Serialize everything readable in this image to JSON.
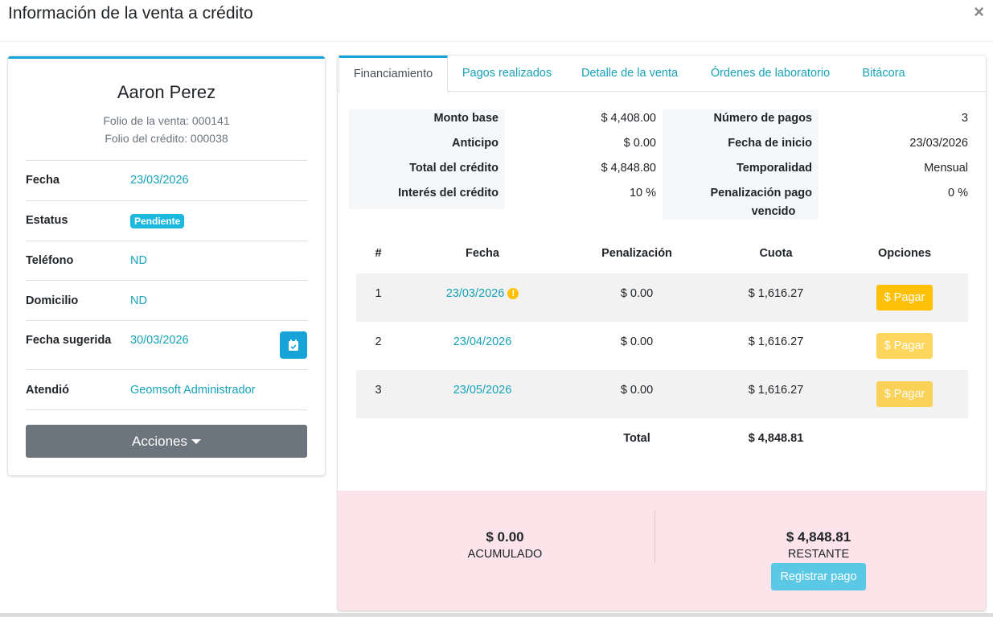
{
  "modal": {
    "title": "Información de la venta a crédito",
    "close_label": "×"
  },
  "client": {
    "name": "Aaron Perez",
    "folio_venta": "Folio de la venta: 000141",
    "folio_credito": "Folio del crédito: 000038",
    "rows": {
      "fecha": {
        "label": "Fecha",
        "value": "23/03/2026"
      },
      "estatus": {
        "label": "Estatus",
        "value": "Pendiente"
      },
      "telefono": {
        "label": "Teléfono",
        "value": "ND"
      },
      "domicilio": {
        "label": "Domicilio",
        "value": "ND"
      },
      "fecha_sugerida": {
        "label": "Fecha sugerida",
        "value": "30/03/2026"
      },
      "atendio": {
        "label": "Atendió",
        "value": "Geomsoft Administrador"
      }
    },
    "acciones_label": "Acciones"
  },
  "tabs": [
    "Financiamiento",
    "Pagos realizados",
    "Detalle de la venta",
    "Órdenes de laboratorio",
    "Bitácora"
  ],
  "financing": {
    "monto_base": {
      "label": "Monto base",
      "value": "$ 4,408.00"
    },
    "anticipo": {
      "label": "Anticipo",
      "value": "$ 0.00"
    },
    "total_credito": {
      "label": "Total del crédito",
      "value": "$ 4,848.80"
    },
    "interes": {
      "label": "Interés del crédito",
      "value": "10 %"
    },
    "numero_pagos": {
      "label": "Número de pagos",
      "value": "3"
    },
    "fecha_inicio": {
      "label": "Fecha de inicio",
      "value": "23/03/2026"
    },
    "temporalidad": {
      "label": "Temporalidad",
      "value": "Mensual"
    },
    "penalizacion": {
      "label_1": "Penalización pago",
      "label_2": "vencido",
      "value": "0 %"
    }
  },
  "table": {
    "headers": [
      "#",
      "Fecha",
      "Penalización",
      "Cuota",
      "Opciones"
    ],
    "rows": [
      {
        "num": "1",
        "fecha": "23/03/2026",
        "penalizacion": "$ 0.00",
        "cuota": "$ 1,616.27",
        "button": "Pagar"
      },
      {
        "num": "2",
        "fecha": "23/04/2026",
        "penalizacion": "$ 0.00",
        "cuota": "$ 1,616.27",
        "button": "Pagar"
      },
      {
        "num": "3",
        "fecha": "23/05/2026",
        "penalizacion": "$ 0.00",
        "cuota": "$ 1,616.27",
        "button": "Pagar"
      }
    ],
    "total_label": "Total",
    "total_value": "$ 4,848.81"
  },
  "summary": {
    "acumulado": {
      "amount": "$ 0.00",
      "label": "ACUMULADO"
    },
    "restante": {
      "amount": "$ 4,848.81",
      "label": "RESTANTE"
    },
    "registrar_label": "Registrar pago"
  },
  "colors": {
    "accent": "#17a2b8",
    "warning": "#ffc107",
    "summary_bg": "#fce4ea",
    "secondary": "#6c757d"
  }
}
